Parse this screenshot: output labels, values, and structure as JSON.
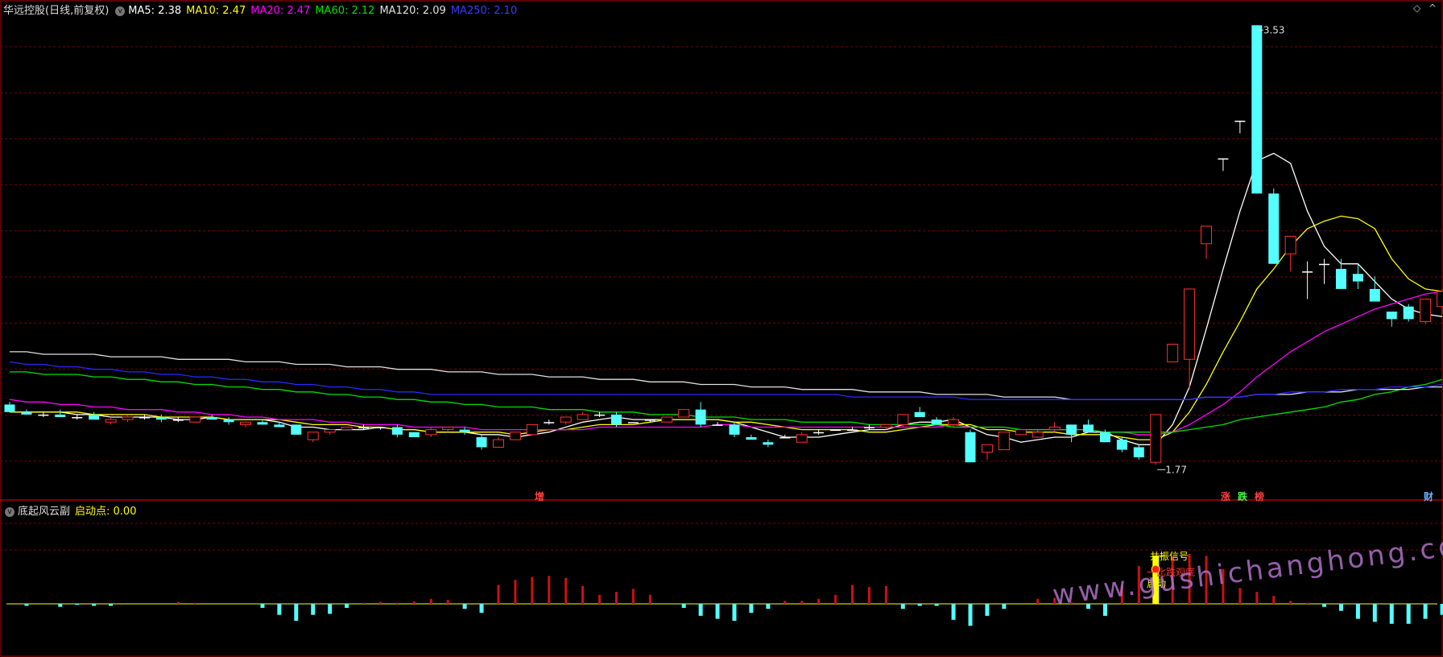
{
  "header": {
    "stock_name": "华远控股(日线,前复权)",
    "ma_items": [
      {
        "label": "MA5: 2.38",
        "color": "#ffffff"
      },
      {
        "label": "MA10: 2.47",
        "color": "#ffff00"
      },
      {
        "label": "MA20: 2.47",
        "color": "#ff00ff"
      },
      {
        "label": "MA60: 2.12",
        "color": "#00e000"
      },
      {
        "label": "MA120: 2.09",
        "color": "#e0e0e0"
      },
      {
        "label": "MA250: 2.10",
        "color": "#2828ff"
      }
    ]
  },
  "price_panel": {
    "high_label": "3.53",
    "low_label": "1.77",
    "events": [
      {
        "label": "增",
        "color": "red"
      },
      {
        "label": "涨",
        "color": "red"
      },
      {
        "label": "跌",
        "color": "grn"
      },
      {
        "label": "榜",
        "color": "red"
      },
      {
        "label": "财",
        "color": "blue"
      }
    ]
  },
  "indicator_panel": {
    "name": "底起风云副",
    "value_label": "启动点: 0.00",
    "signal_labels": [
      "共振信号",
      "一比跌观底",
      "启动"
    ]
  },
  "watermark": "www.gushichanghong.com",
  "colors": {
    "up": "#ff3030",
    "down": "#54ffff",
    "border": "#b00000",
    "grid": "#7a0000"
  },
  "chart_data": {
    "type": "candlestick",
    "candles": [
      [
        2.02,
        2.03,
        1.99,
        1.99
      ],
      [
        1.99,
        2.0,
        1.98,
        1.98
      ],
      [
        1.98,
        1.99,
        1.97,
        1.98
      ],
      [
        1.98,
        2.0,
        1.97,
        1.97
      ],
      [
        1.97,
        1.98,
        1.96,
        1.97
      ],
      [
        1.98,
        1.99,
        1.96,
        1.96
      ],
      [
        1.95,
        1.97,
        1.94,
        1.96
      ],
      [
        1.96,
        1.98,
        1.95,
        1.97
      ],
      [
        1.97,
        1.98,
        1.96,
        1.97
      ],
      [
        1.97,
        1.98,
        1.95,
        1.96
      ],
      [
        1.96,
        1.97,
        1.95,
        1.96
      ],
      [
        1.95,
        1.97,
        1.95,
        1.97
      ],
      [
        1.97,
        1.98,
        1.96,
        1.96
      ],
      [
        1.96,
        1.97,
        1.94,
        1.95
      ],
      [
        1.94,
        1.95,
        1.93,
        1.95
      ],
      [
        1.95,
        1.96,
        1.94,
        1.94
      ],
      [
        1.94,
        1.95,
        1.93,
        1.93
      ],
      [
        1.94,
        1.94,
        1.9,
        1.9
      ],
      [
        1.88,
        1.91,
        1.87,
        1.91
      ],
      [
        1.91,
        1.92,
        1.9,
        1.92
      ],
      [
        1.92,
        1.93,
        1.92,
        1.93
      ],
      [
        1.93,
        1.94,
        1.92,
        1.93
      ],
      [
        1.93,
        1.93,
        1.92,
        1.93
      ],
      [
        1.93,
        1.94,
        1.89,
        1.9
      ],
      [
        1.91,
        1.91,
        1.89,
        1.89
      ],
      [
        1.9,
        1.93,
        1.89,
        1.92
      ],
      [
        1.92,
        1.93,
        1.91,
        1.93
      ],
      [
        1.92,
        1.93,
        1.9,
        1.91
      ],
      [
        1.89,
        1.9,
        1.84,
        1.85
      ],
      [
        1.85,
        1.89,
        1.85,
        1.88
      ],
      [
        1.88,
        1.91,
        1.88,
        1.91
      ],
      [
        1.9,
        1.94,
        1.9,
        1.94
      ],
      [
        1.95,
        1.96,
        1.94,
        1.95
      ],
      [
        1.95,
        1.97,
        1.94,
        1.97
      ],
      [
        1.96,
        1.99,
        1.96,
        1.98
      ],
      [
        1.98,
        1.99,
        1.97,
        1.98
      ],
      [
        1.98,
        1.99,
        1.93,
        1.94
      ],
      [
        1.95,
        1.95,
        1.95,
        1.95
      ],
      [
        1.96,
        1.96,
        1.95,
        1.96
      ],
      [
        1.95,
        1.97,
        1.95,
        1.97
      ],
      [
        1.97,
        2.0,
        1.97,
        2.0
      ],
      [
        2.0,
        2.03,
        1.93,
        1.94
      ],
      [
        1.94,
        1.95,
        1.94,
        1.94
      ],
      [
        1.94,
        1.95,
        1.89,
        1.9
      ],
      [
        1.89,
        1.9,
        1.88,
        1.88
      ],
      [
        1.87,
        1.88,
        1.85,
        1.86
      ],
      [
        1.89,
        1.9,
        1.89,
        1.89
      ],
      [
        1.87,
        1.91,
        1.87,
        1.9
      ],
      [
        1.91,
        1.92,
        1.9,
        1.91
      ],
      [
        1.92,
        1.92,
        1.92,
        1.92
      ],
      [
        1.92,
        1.93,
        1.92,
        1.92
      ],
      [
        1.93,
        1.94,
        1.92,
        1.93
      ],
      [
        1.93,
        1.94,
        1.92,
        1.94
      ],
      [
        1.94,
        1.98,
        1.93,
        1.98
      ],
      [
        1.99,
        2.01,
        1.97,
        1.97
      ],
      [
        1.96,
        1.97,
        1.94,
        1.94
      ],
      [
        1.94,
        1.97,
        1.93,
        1.96
      ],
      [
        1.91,
        1.92,
        1.79,
        1.79
      ],
      [
        1.83,
        1.86,
        1.8,
        1.86
      ],
      [
        1.84,
        1.91,
        1.84,
        1.91
      ],
      [
        1.9,
        1.92,
        1.9,
        1.92
      ],
      [
        1.89,
        1.92,
        1.89,
        1.91
      ],
      [
        1.92,
        1.95,
        1.91,
        1.93
      ],
      [
        1.94,
        1.94,
        1.87,
        1.9
      ],
      [
        1.94,
        1.96,
        1.91,
        1.91
      ],
      [
        1.91,
        1.92,
        1.87,
        1.87
      ],
      [
        1.88,
        1.89,
        1.83,
        1.84
      ],
      [
        1.85,
        1.86,
        1.8,
        1.81
      ],
      [
        1.79,
        1.98,
        1.78,
        1.98
      ],
      [
        2.19,
        2.26,
        2.19,
        2.26
      ],
      [
        2.2,
        2.48,
        2.08,
        2.48
      ],
      [
        2.66,
        2.73,
        2.6,
        2.73
      ],
      [
        3.0,
        3.0,
        2.95,
        3.0
      ],
      [
        3.15,
        3.15,
        3.1,
        3.15
      ],
      [
        3.53,
        3.53,
        2.86,
        2.86
      ],
      [
        2.86,
        2.88,
        2.58,
        2.58
      ],
      [
        2.62,
        2.69,
        2.55,
        2.69
      ],
      [
        2.55,
        2.59,
        2.44,
        2.55
      ],
      [
        2.58,
        2.6,
        2.5,
        2.58
      ],
      [
        2.56,
        2.6,
        2.48,
        2.48
      ],
      [
        2.54,
        2.58,
        2.48,
        2.51
      ],
      [
        2.48,
        2.53,
        2.43,
        2.43
      ],
      [
        2.39,
        2.39,
        2.33,
        2.36
      ],
      [
        2.41,
        2.42,
        2.35,
        2.36
      ],
      [
        2.35,
        2.44,
        2.34,
        2.44
      ],
      [
        2.41,
        2.48,
        2.38,
        2.47
      ]
    ],
    "ma_lines": [
      {
        "name": "MA5",
        "color": "#ffffff",
        "values": [
          1.99,
          1.99,
          1.99,
          1.99,
          1.98,
          1.98,
          1.97,
          1.97,
          1.97,
          1.97,
          1.96,
          1.96,
          1.97,
          1.96,
          1.96,
          1.96,
          1.95,
          1.93,
          1.93,
          1.92,
          1.92,
          1.92,
          1.93,
          1.92,
          1.92,
          1.91,
          1.91,
          1.91,
          1.9,
          1.9,
          1.89,
          1.9,
          1.91,
          1.93,
          1.95,
          1.96,
          1.97,
          1.96,
          1.96,
          1.96,
          1.96,
          1.96,
          1.96,
          1.95,
          1.93,
          1.91,
          1.89,
          1.89,
          1.89,
          1.9,
          1.91,
          1.92,
          1.92,
          1.94,
          1.95,
          1.95,
          1.96,
          1.93,
          1.9,
          1.89,
          1.87,
          1.88,
          1.89,
          1.89,
          1.91,
          1.91,
          1.88,
          1.86,
          1.86,
          1.94,
          2.09,
          2.32,
          2.56,
          2.79,
          2.99,
          3.02,
          2.98,
          2.79,
          2.65,
          2.58,
          2.58,
          2.51,
          2.44,
          2.4,
          2.38,
          2.37
        ]
      },
      {
        "name": "MA10",
        "color": "#ffff00",
        "values": [
          1.99,
          1.99,
          1.99,
          1.99,
          1.99,
          1.98,
          1.98,
          1.98,
          1.98,
          1.97,
          1.97,
          1.97,
          1.97,
          1.96,
          1.96,
          1.96,
          1.96,
          1.95,
          1.94,
          1.94,
          1.94,
          1.93,
          1.93,
          1.92,
          1.92,
          1.91,
          1.91,
          1.91,
          1.91,
          1.91,
          1.9,
          1.91,
          1.92,
          1.92,
          1.93,
          1.94,
          1.94,
          1.94,
          1.95,
          1.96,
          1.96,
          1.96,
          1.96,
          1.95,
          1.95,
          1.94,
          1.93,
          1.92,
          1.92,
          1.92,
          1.92,
          1.91,
          1.91,
          1.92,
          1.93,
          1.94,
          1.94,
          1.94,
          1.92,
          1.92,
          1.91,
          1.91,
          1.91,
          1.9,
          1.9,
          1.9,
          1.89,
          1.88,
          1.88,
          1.91,
          1.99,
          2.1,
          2.23,
          2.35,
          2.48,
          2.56,
          2.65,
          2.72,
          2.75,
          2.77,
          2.76,
          2.72,
          2.6,
          2.52,
          2.48,
          2.47
        ]
      },
      {
        "name": "MA20",
        "color": "#ff00ff",
        "values": [
          2.04,
          2.03,
          2.03,
          2.02,
          2.02,
          2.01,
          2.01,
          2.0,
          2.0,
          2.0,
          1.99,
          1.99,
          1.98,
          1.98,
          1.97,
          1.97,
          1.96,
          1.96,
          1.96,
          1.95,
          1.95,
          1.94,
          1.94,
          1.94,
          1.93,
          1.93,
          1.93,
          1.93,
          1.92,
          1.92,
          1.92,
          1.92,
          1.92,
          1.92,
          1.92,
          1.93,
          1.93,
          1.93,
          1.93,
          1.93,
          1.93,
          1.93,
          1.94,
          1.94,
          1.93,
          1.93,
          1.93,
          1.93,
          1.93,
          1.93,
          1.93,
          1.93,
          1.93,
          1.93,
          1.93,
          1.93,
          1.94,
          1.93,
          1.93,
          1.93,
          1.92,
          1.92,
          1.92,
          1.92,
          1.92,
          1.91,
          1.91,
          1.9,
          1.9,
          1.91,
          1.94,
          1.98,
          2.02,
          2.07,
          2.13,
          2.18,
          2.23,
          2.27,
          2.31,
          2.34,
          2.37,
          2.4,
          2.42,
          2.44,
          2.46,
          2.47
        ]
      },
      {
        "name": "MA60",
        "color": "#00e000",
        "values": [
          2.15,
          2.15,
          2.14,
          2.14,
          2.14,
          2.13,
          2.13,
          2.12,
          2.12,
          2.11,
          2.11,
          2.1,
          2.1,
          2.09,
          2.09,
          2.08,
          2.08,
          2.07,
          2.07,
          2.06,
          2.06,
          2.05,
          2.05,
          2.04,
          2.04,
          2.03,
          2.03,
          2.02,
          2.02,
          2.01,
          2.01,
          2.01,
          2.0,
          2.0,
          2.0,
          1.99,
          1.99,
          1.99,
          1.98,
          1.98,
          1.98,
          1.97,
          1.97,
          1.97,
          1.96,
          1.96,
          1.96,
          1.95,
          1.95,
          1.95,
          1.95,
          1.94,
          1.94,
          1.94,
          1.94,
          1.94,
          1.93,
          1.93,
          1.93,
          1.93,
          1.92,
          1.92,
          1.92,
          1.92,
          1.92,
          1.91,
          1.91,
          1.91,
          1.91,
          1.91,
          1.92,
          1.93,
          1.94,
          1.96,
          1.97,
          1.98,
          1.99,
          2.0,
          2.01,
          2.03,
          2.04,
          2.06,
          2.07,
          2.09,
          2.1,
          2.12
        ]
      },
      {
        "name": "MA120",
        "color": "#e0e0e0",
        "values": [
          2.23,
          2.23,
          2.22,
          2.22,
          2.22,
          2.22,
          2.21,
          2.21,
          2.21,
          2.21,
          2.2,
          2.2,
          2.2,
          2.2,
          2.19,
          2.19,
          2.19,
          2.18,
          2.18,
          2.18,
          2.17,
          2.17,
          2.17,
          2.16,
          2.16,
          2.16,
          2.15,
          2.15,
          2.15,
          2.14,
          2.14,
          2.14,
          2.13,
          2.13,
          2.13,
          2.12,
          2.12,
          2.12,
          2.11,
          2.11,
          2.11,
          2.1,
          2.1,
          2.1,
          2.09,
          2.09,
          2.09,
          2.08,
          2.08,
          2.08,
          2.08,
          2.07,
          2.07,
          2.07,
          2.07,
          2.06,
          2.06,
          2.06,
          2.06,
          2.05,
          2.05,
          2.05,
          2.05,
          2.04,
          2.04,
          2.04,
          2.04,
          2.04,
          2.04,
          2.04,
          2.04,
          2.05,
          2.05,
          2.05,
          2.06,
          2.06,
          2.06,
          2.07,
          2.07,
          2.07,
          2.08,
          2.08,
          2.08,
          2.08,
          2.09,
          2.09
        ]
      },
      {
        "name": "MA250",
        "color": "#2828ff",
        "values": [
          2.19,
          2.18,
          2.18,
          2.17,
          2.17,
          2.16,
          2.16,
          2.15,
          2.15,
          2.14,
          2.14,
          2.13,
          2.13,
          2.12,
          2.12,
          2.11,
          2.11,
          2.1,
          2.1,
          2.09,
          2.09,
          2.08,
          2.08,
          2.07,
          2.07,
          2.06,
          2.06,
          2.06,
          2.06,
          2.06,
          2.06,
          2.06,
          2.06,
          2.06,
          2.06,
          2.06,
          2.06,
          2.06,
          2.06,
          2.06,
          2.06,
          2.06,
          2.06,
          2.06,
          2.06,
          2.06,
          2.06,
          2.06,
          2.06,
          2.06,
          2.05,
          2.05,
          2.05,
          2.05,
          2.05,
          2.05,
          2.05,
          2.04,
          2.04,
          2.04,
          2.04,
          2.04,
          2.04,
          2.04,
          2.04,
          2.04,
          2.04,
          2.04,
          2.04,
          2.04,
          2.04,
          2.05,
          2.05,
          2.05,
          2.06,
          2.06,
          2.07,
          2.07,
          2.07,
          2.08,
          2.08,
          2.08,
          2.09,
          2.09,
          2.09,
          2.1
        ]
      }
    ],
    "indicator_bars": [
      0,
      -0.4,
      0,
      -0.6,
      -0.2,
      -0.4,
      -0.4,
      0,
      0,
      0,
      0.4,
      0.2,
      0,
      0,
      0,
      -0.8,
      -2.2,
      -3.4,
      -2.2,
      -2.0,
      -0.8,
      0.2,
      0.4,
      0.2,
      0.5,
      1.0,
      0.8,
      -1.0,
      -1.8,
      3.8,
      4.8,
      5.4,
      5.6,
      5.2,
      3.6,
      1.8,
      2.4,
      3.0,
      1.8,
      0,
      -0.8,
      -2.4,
      -3.0,
      -3.4,
      -1.8,
      -1.0,
      0.6,
      0.6,
      1.0,
      1.8,
      3.8,
      3.4,
      3.6,
      -1.0,
      -0.4,
      -0.4,
      -3.2,
      -4.4,
      -2.4,
      -1.0,
      0,
      1.0,
      1.2,
      0.3,
      -1.0,
      -2.4,
      3.6,
      7.6,
      8.4,
      9.6,
      10.0,
      9.6,
      7.0,
      3.2,
      2.4,
      1.6,
      0.6,
      0.2,
      -0.6,
      -1.4,
      -3.0,
      -3.6,
      -4.0,
      -4.0,
      -3.0,
      -2.2
    ]
  }
}
